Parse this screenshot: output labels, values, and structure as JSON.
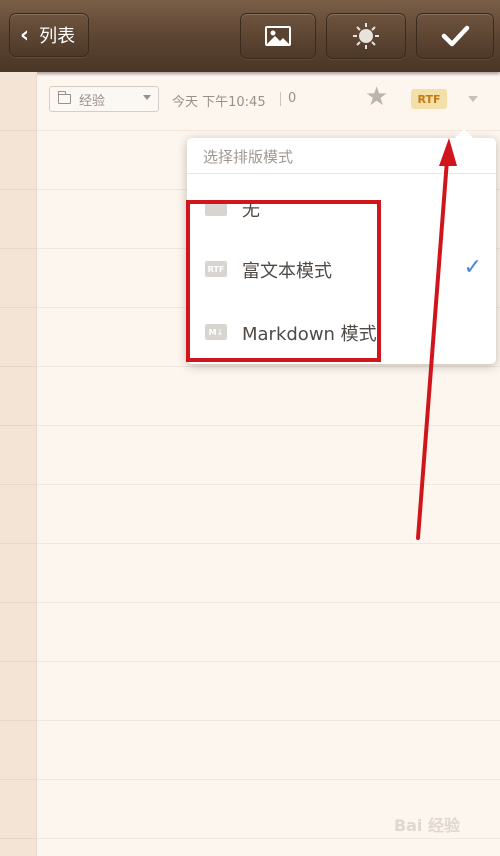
{
  "toolbar": {
    "back_label": "列表",
    "image_icon": "image-icon",
    "theme_icon": "sun-icon",
    "save_icon": "checkmark-icon"
  },
  "meta": {
    "folder": "经验",
    "date": "今天 下午10:45",
    "word_count": "0",
    "format_badge": "RTF"
  },
  "popover": {
    "title": "选择排版模式",
    "options": [
      {
        "icon_text": "",
        "label": "无",
        "selected": false
      },
      {
        "icon_text": "RTF",
        "label": "富文本模式",
        "selected": true
      },
      {
        "icon_text": "M↓",
        "label": "Markdown 模式",
        "selected": false
      }
    ]
  },
  "colors": {
    "accent_check": "#4a86d6",
    "annotation_red": "#d0161c",
    "badge_bg": "#f4dfa8"
  },
  "watermark": "Bai 经验"
}
